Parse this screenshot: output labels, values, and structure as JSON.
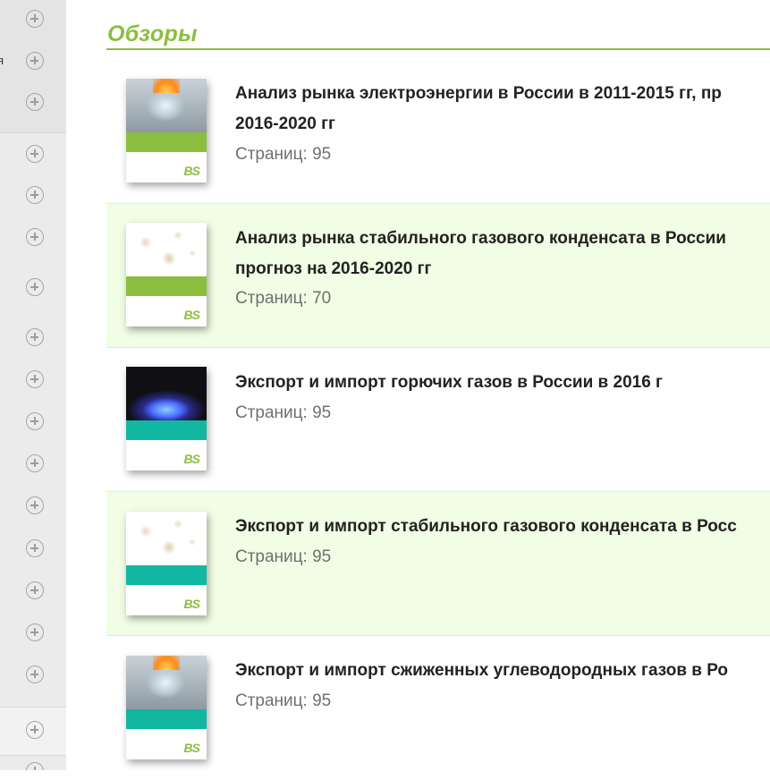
{
  "sidebar": {
    "cut_text": "я",
    "expand_icon_count": 18
  },
  "section": {
    "title": "Обзоры"
  },
  "items": [
    {
      "title_line1": "Анализ рынка электроэнергии в России в 2011-2015 гг, пр",
      "title_line2": "2016-2020 гг",
      "pages": "Страниц: 95",
      "cover_image": "ice-flame",
      "cover_band_color": "#8bbe3f",
      "cover_logo": "BS"
    },
    {
      "title_line1": "Анализ рынка стабильного газового конденсата в России",
      "title_line2": "прогноз на 2016-2020 гг",
      "pages": "Страниц: 70",
      "cover_image": "bubbles",
      "cover_band_color": "#8bbe3f",
      "cover_logo": "BS"
    },
    {
      "title_line1": "Экспорт и импорт горючих газов в России в 2016 г",
      "title_line2": "",
      "pages": "Страниц: 95",
      "cover_image": "gas-burner",
      "cover_band_color": "#12b7a1",
      "cover_logo": "BS"
    },
    {
      "title_line1": "Экспорт и импорт стабильного газового конденсата в Росс",
      "title_line2": "",
      "pages": "Страниц: 95",
      "cover_image": "bubbles",
      "cover_band_color": "#12b7a1",
      "cover_logo": "BS"
    },
    {
      "title_line1": "Экспорт и импорт сжиженных углеводородных газов в Ро",
      "title_line2": "",
      "pages": "Страниц: 95",
      "cover_image": "ice-flame",
      "cover_band_color": "#12b7a1",
      "cover_logo": "BS"
    }
  ],
  "colors": {
    "accent": "#8bbe3f",
    "teal": "#12b7a1",
    "alt_row": "#f1fde4"
  }
}
